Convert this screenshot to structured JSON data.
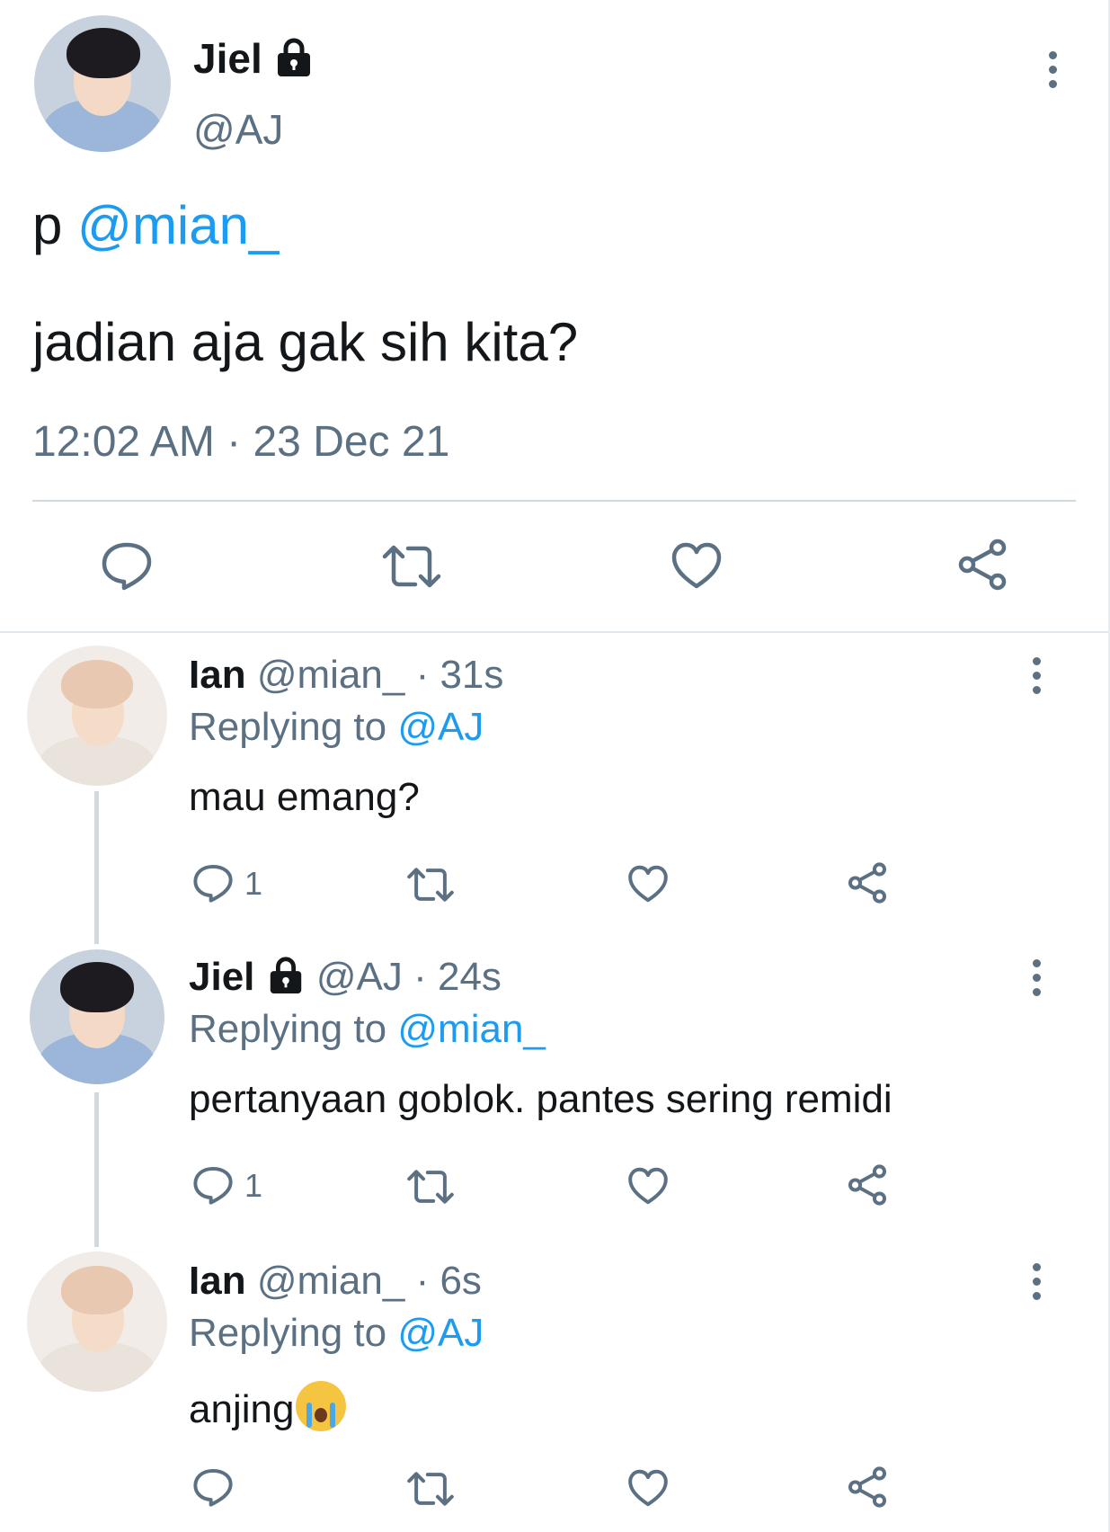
{
  "main_tweet": {
    "author_name": "Jiel",
    "author_handle": "@AJ",
    "line1_prefix": "p ",
    "line1_mention": "@mian_",
    "line2": "jadian aja gak sih kita?",
    "timestamp": "12:02 AM · 23 Dec 21"
  },
  "replies": [
    {
      "name": "Ian",
      "handle": "@mian_",
      "time": "· 31s",
      "replying_label": "Replying to",
      "replying_to": "@AJ",
      "text": "mau emang?",
      "reply_count": "1",
      "avatar": "ian"
    },
    {
      "name": "Jiel",
      "handle": "@AJ",
      "time": "· 24s",
      "replying_label": "Replying to",
      "replying_to": "@mian_",
      "text": "pertanyaan goblok. pantes sering remidi",
      "reply_count": "1",
      "avatar": "jiel"
    },
    {
      "name": "Ian",
      "handle": "@mian_",
      "time": "· 6s",
      "replying_label": "Replying to",
      "replying_to": "@AJ",
      "text": "anjing",
      "emoji": "loudly-crying-face",
      "reply_count": "",
      "avatar": "ian"
    }
  ],
  "colors": {
    "accent": "#1d9bf0",
    "secondary_text": "#5b7083",
    "divider": "#cfd9de"
  }
}
